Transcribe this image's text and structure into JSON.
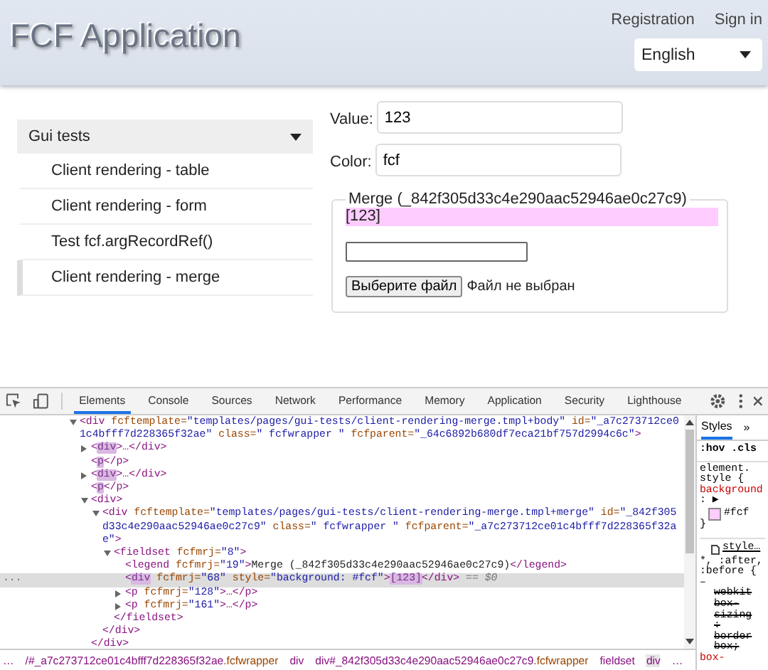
{
  "header": {
    "title": "FCF Application",
    "links": [
      "Registration",
      "Sign in"
    ],
    "language": "English"
  },
  "sidebar": {
    "group": "Gui tests",
    "expanded": true,
    "items": [
      {
        "label": "Client rendering - table",
        "selected": false
      },
      {
        "label": "Client rendering - form",
        "selected": false
      },
      {
        "label": "Test fcf.argRecordRef()",
        "selected": false
      },
      {
        "label": "Client rendering - merge",
        "selected": true
      }
    ]
  },
  "form": {
    "value_label": "Value:",
    "value": "123",
    "color_label": "Color:",
    "color_value": "fcf",
    "fieldset": {
      "legend": "Merge (_842f305d33c4e290aac52946ae0c27c9)",
      "output": "[123]",
      "file_button": "Выберите файл",
      "file_status": "Файл не выбран"
    }
  },
  "devtools": {
    "tabs": [
      {
        "label": "Elements",
        "selected": true
      },
      {
        "label": "Console",
        "selected": false
      },
      {
        "label": "Sources",
        "selected": false
      },
      {
        "label": "Network",
        "selected": false
      },
      {
        "label": "Performance",
        "selected": false
      },
      {
        "label": "Memory",
        "selected": false
      },
      {
        "label": "Application",
        "selected": false
      },
      {
        "label": "Security",
        "selected": false
      },
      {
        "label": "Lighthouse",
        "selected": false
      }
    ],
    "dom": [
      {
        "expanded": true,
        "selected": false,
        "parts": [
          {
            "kind": "tag",
            "text": "<div"
          },
          {
            "kind": "attr",
            "text": " fcftemplate="
          },
          {
            "kind": "val",
            "text": "\"templates/pages/gui-tests/client-rendering-merge.tmpl+body\""
          },
          {
            "kind": "attr",
            "text": " id="
          },
          {
            "kind": "val",
            "text": "\"_a7c273712ce01c4bfff7d228365f32ae\""
          },
          {
            "kind": "attr",
            "text": " class="
          },
          {
            "kind": "val",
            "text": "\" fcfwrapper  \""
          },
          {
            "kind": "attr",
            "text": " fcfparent="
          },
          {
            "kind": "val",
            "text": "\"_64c6892b680df7eca21bf757d2994c6c\""
          },
          {
            "kind": "tag",
            "text": ">"
          }
        ],
        "children": [
          {
            "expanded": false,
            "selected": false,
            "parts": [
              {
                "kind": "tag",
                "text": "<"
              },
              {
                "kind": "hit",
                "text": "div"
              },
              {
                "kind": "tag",
                "text": ">…</div>"
              }
            ]
          },
          {
            "selected": false,
            "parts": [
              {
                "kind": "tag",
                "text": "<"
              },
              {
                "kind": "hit",
                "text": "p"
              },
              {
                "kind": "tag",
                "text": "</p>"
              }
            ]
          },
          {
            "expanded": false,
            "selected": false,
            "parts": [
              {
                "kind": "tag",
                "text": "<"
              },
              {
                "kind": "hit",
                "text": "div"
              },
              {
                "kind": "tag",
                "text": ">…</div>"
              }
            ]
          },
          {
            "selected": false,
            "parts": [
              {
                "kind": "tag",
                "text": "<"
              },
              {
                "kind": "hit",
                "text": "p"
              },
              {
                "kind": "tag",
                "text": "</p>"
              }
            ]
          },
          {
            "expanded": true,
            "selected": false,
            "parts": [
              {
                "kind": "tag",
                "text": "<div>"
              }
            ],
            "close": "</div>",
            "children": [
              {
                "expanded": true,
                "selected": false,
                "parts": [
                  {
                    "kind": "tag",
                    "text": "<div"
                  },
                  {
                    "kind": "attr",
                    "text": " fcftemplate="
                  },
                  {
                    "kind": "val",
                    "text": "\"templates/pages/gui-tests/client-rendering-merge.tmpl+merge\""
                  },
                  {
                    "kind": "attr",
                    "text": " id="
                  },
                  {
                    "kind": "val",
                    "text": "\"_842f305d33c4e290aac52946ae0c27c9\""
                  },
                  {
                    "kind": "attr",
                    "text": " class="
                  },
                  {
                    "kind": "val",
                    "text": "\" fcfwrapper  \""
                  },
                  {
                    "kind": "attr",
                    "text": " fcfparent="
                  },
                  {
                    "kind": "val",
                    "text": "\"_a7c273712ce01c4bfff7d228365f32ae\""
                  },
                  {
                    "kind": "tag",
                    "text": ">"
                  }
                ],
                "close": "</div>",
                "children": [
                  {
                    "expanded": true,
                    "selected": false,
                    "parts": [
                      {
                        "kind": "tag",
                        "text": "<fieldset"
                      },
                      {
                        "kind": "attr",
                        "text": " fcfmrj="
                      },
                      {
                        "kind": "val",
                        "text": "\"8\""
                      },
                      {
                        "kind": "tag",
                        "text": ">"
                      }
                    ],
                    "close": "</fieldset>",
                    "children": [
                      {
                        "selected": false,
                        "parts": [
                          {
                            "kind": "tag",
                            "text": "<legend"
                          },
                          {
                            "kind": "attr",
                            "text": " fcfmrj="
                          },
                          {
                            "kind": "val",
                            "text": "\"19\""
                          },
                          {
                            "kind": "tag",
                            "text": ">"
                          },
                          {
                            "kind": "text",
                            "text": "Merge (_842f305d33c4e290aac52946ae0c27c9)"
                          },
                          {
                            "kind": "tag",
                            "text": "</legend>"
                          }
                        ]
                      },
                      {
                        "selected": true,
                        "gutter": "...",
                        "parts": [
                          {
                            "kind": "tag",
                            "text": "<"
                          },
                          {
                            "kind": "hit",
                            "text": "div"
                          },
                          {
                            "kind": "attr",
                            "text": " fcfmrj="
                          },
                          {
                            "kind": "val",
                            "text": "\"68\""
                          },
                          {
                            "kind": "attr",
                            "text": " style="
                          },
                          {
                            "kind": "val",
                            "text": "\"background: #fcf\""
                          },
                          {
                            "kind": "tag",
                            "text": ">"
                          },
                          {
                            "kind": "hit",
                            "text": "[123]"
                          },
                          {
                            "kind": "tag",
                            "text": "</div>"
                          },
                          {
                            "kind": "dim",
                            "text": " == $0"
                          }
                        ]
                      },
                      {
                        "expanded": false,
                        "selected": false,
                        "parts": [
                          {
                            "kind": "tag",
                            "text": "<p"
                          },
                          {
                            "kind": "attr",
                            "text": " fcfmrj="
                          },
                          {
                            "kind": "val",
                            "text": "\"128\""
                          },
                          {
                            "kind": "tag",
                            "text": ">…</p>"
                          }
                        ]
                      },
                      {
                        "expanded": false,
                        "selected": false,
                        "parts": [
                          {
                            "kind": "tag",
                            "text": "<p"
                          },
                          {
                            "kind": "attr",
                            "text": " fcfmrj="
                          },
                          {
                            "kind": "val",
                            "text": "\"161\""
                          },
                          {
                            "kind": "tag",
                            "text": ">…</p>"
                          }
                        ]
                      }
                    ]
                  }
                ]
              }
            ]
          }
        ]
      }
    ],
    "styles": {
      "tab": "Styles",
      "more": "»",
      "filter": ":hov .cls",
      "rules": [
        {
          "kind": "selector",
          "text": "element."
        },
        {
          "kind": "selector",
          "text": "style {"
        },
        {
          "kind": "prop",
          "text": "background"
        },
        {
          "kind": "plain",
          "text": ": ▶"
        },
        {
          "kind": "swatch",
          "text": "#fcf",
          "color": "#ffccff"
        },
        {
          "kind": "plain",
          "text": "}"
        },
        {
          "kind": "link",
          "text": "style…"
        },
        {
          "kind": "selector",
          "text": "*, :after,"
        },
        {
          "kind": "selector",
          "text": ":before {"
        },
        {
          "kind": "plain",
          "text": "–"
        },
        {
          "kind": "struck",
          "text": "webkit"
        },
        {
          "kind": "struck",
          "text": "box-"
        },
        {
          "kind": "struck",
          "text": "sizing"
        },
        {
          "kind": "struck",
          "text": ":"
        },
        {
          "kind": "struck",
          "text": "border"
        },
        {
          "kind": "struck",
          "text": "box;"
        },
        {
          "kind": "prop",
          "text": "box-"
        }
      ]
    },
    "breadcrumbs": [
      {
        "text": "…",
        "selected": false
      },
      {
        "text": "/#_a7c273712ce01c4bfff7d228365f32ae",
        "cls": ".fcfwrapper",
        "selected": false
      },
      {
        "text": "div",
        "selected": false
      },
      {
        "text": "div#_842f305d33c4e290aac52946ae0c27c9",
        "cls": ".fcfwrapper",
        "selected": false
      },
      {
        "text": "fieldset",
        "selected": false
      },
      {
        "text": "div",
        "selected": true
      },
      {
        "text": "…",
        "selected": false
      }
    ]
  }
}
